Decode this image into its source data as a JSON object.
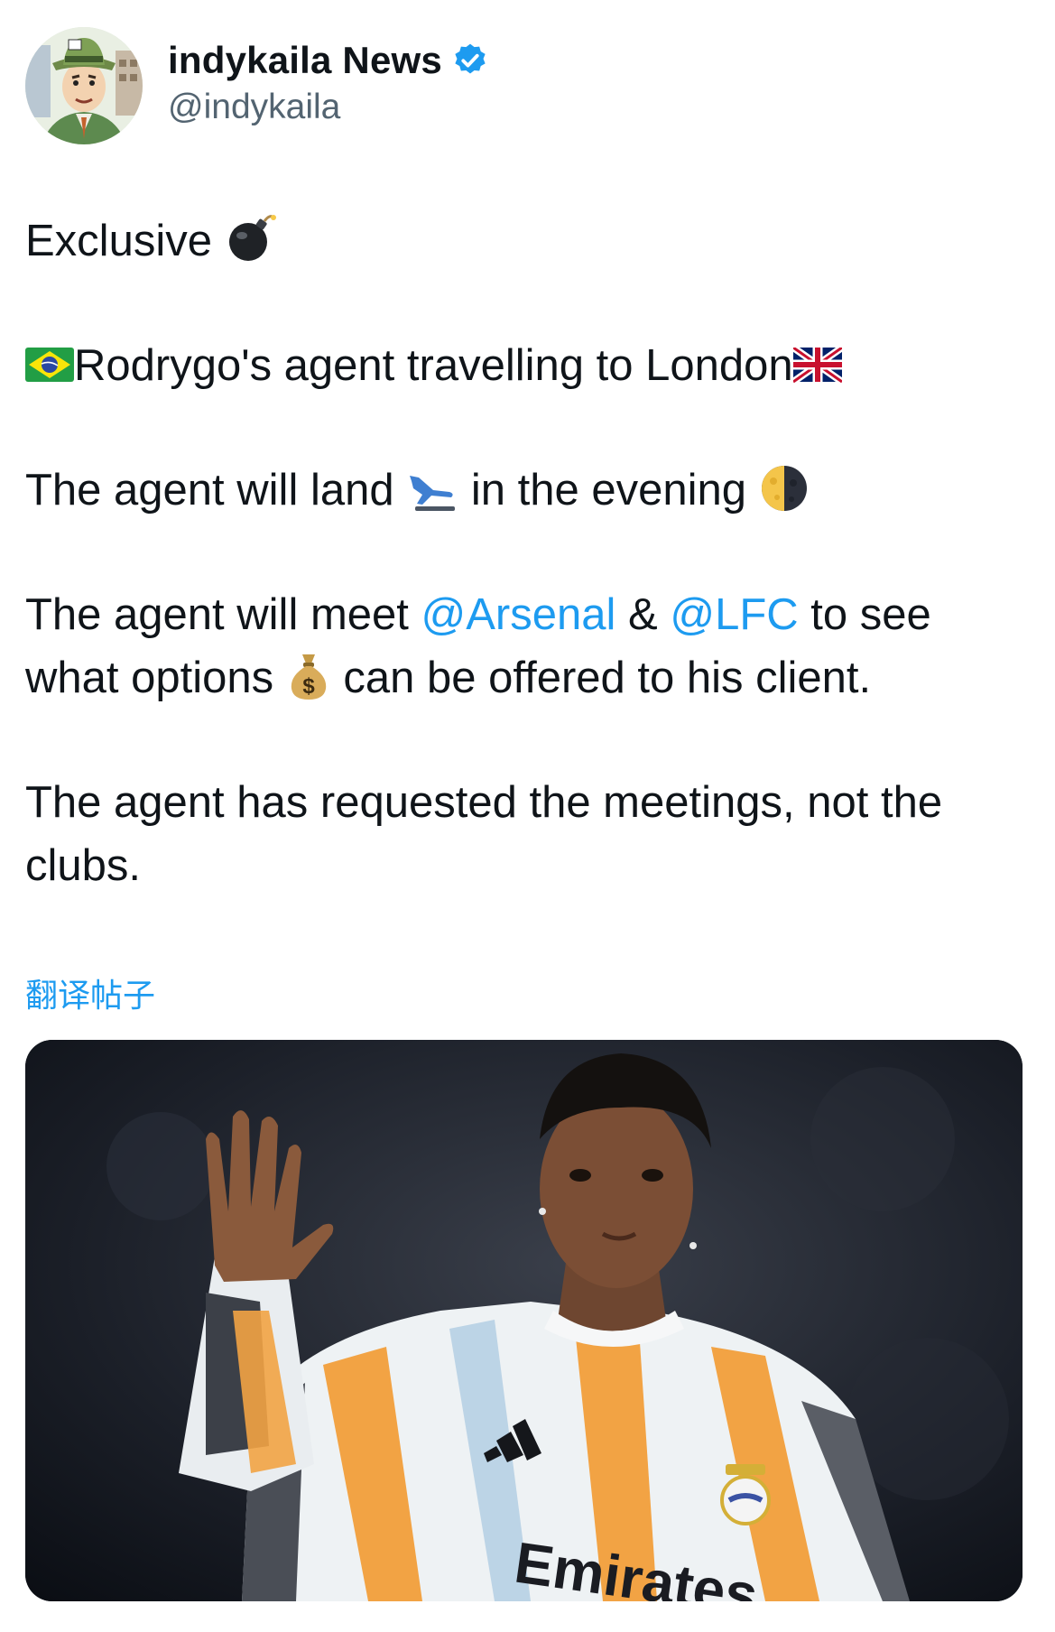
{
  "author": {
    "display_name": "indykaila News",
    "handle": "@indykaila",
    "verified": true,
    "verified_color": "#1d9bf0"
  },
  "tweet": {
    "line1": "Exclusive",
    "line1_emoji": "bomb-emoji",
    "line2_prefix_emoji": "brazil-flag-emoji",
    "line2": "Rodrygo's agent travelling to London",
    "line2_suffix_emoji": "uk-flag-emoji",
    "line3_a": "The agent will land",
    "line3_emoji_a": "airplane-landing-emoji",
    "line3_b": "in the evening",
    "line3_emoji_b": "moon-emoji",
    "line4_a": "The agent will meet",
    "mention_1": "@Arsenal",
    "line4_amp": "&",
    "mention_2": "@LFC",
    "line4_b": "to see",
    "line5_a": "what options",
    "line5_emoji": "money-bag-emoji",
    "line5_b": "can be offered to his client.",
    "line6": "The agent has requested the meetings, not the",
    "line7": "clubs."
  },
  "translate_label": "翻译帖子",
  "media": {
    "type": "photo",
    "jersey_text": "Emirates",
    "description_icons": [
      "adidas-logo",
      "real-madrid-crest"
    ]
  },
  "colors": {
    "text": "#0f1419",
    "secondary": "#536471",
    "link": "#1d9bf0"
  }
}
